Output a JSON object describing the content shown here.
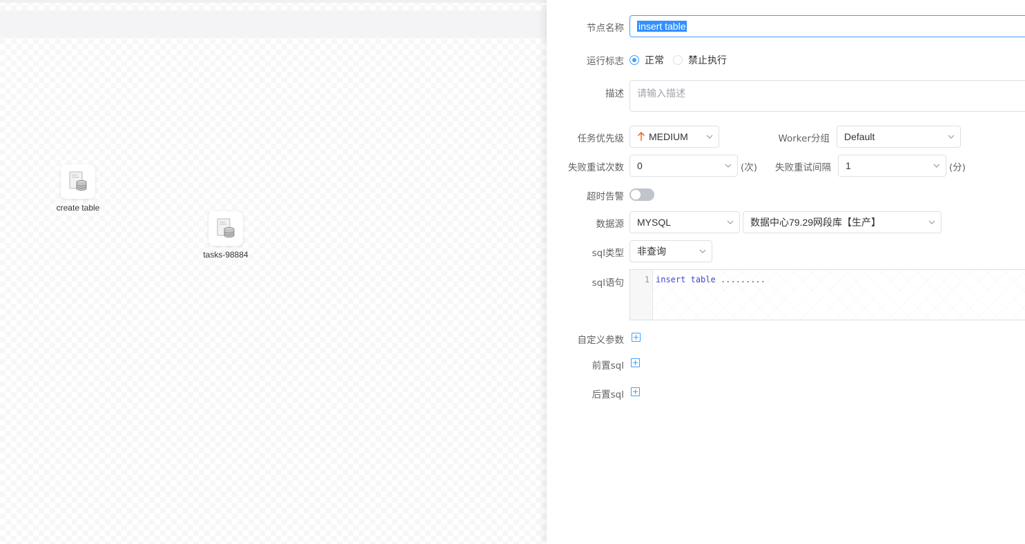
{
  "canvas": {
    "nodes": [
      {
        "label": "create table",
        "icon": "sql-database-icon"
      },
      {
        "label": "tasks-98884",
        "icon": "sql-database-icon"
      }
    ]
  },
  "form": {
    "node_name": {
      "label": "节点名称",
      "value": "insert table"
    },
    "run_flag": {
      "label": "运行标志",
      "options": [
        "正常",
        "禁止执行"
      ],
      "selected": "正常"
    },
    "description": {
      "label": "描述",
      "placeholder": "请输入描述"
    },
    "priority": {
      "label": "任务优先级",
      "value": "MEDIUM",
      "icon": "arrow-up-icon",
      "color": "#f56c2d"
    },
    "worker_group": {
      "label": "Worker分组",
      "value": "Default"
    },
    "retry_times": {
      "label": "失败重试次数",
      "value": "0",
      "suffix": "(次)"
    },
    "retry_interval": {
      "label": "失败重试间隔",
      "value": "1",
      "suffix": "(分)"
    },
    "timeout_alert": {
      "label": "超时告警",
      "enabled": false
    },
    "datasource": {
      "label": "数据源",
      "type": "MYSQL",
      "instance": "数据中心79.29网段库【生产】"
    },
    "sql_type": {
      "label": "sql类型",
      "value": "非查询"
    },
    "sql_statement": {
      "label": "sql语句",
      "line_number": "1",
      "keyword1": "insert",
      "keyword2": "table",
      "rest": "........."
    },
    "custom_params": {
      "label": "自定义参数"
    },
    "pre_sql": {
      "label": "前置sql"
    },
    "post_sql": {
      "label": "后置sql"
    }
  },
  "colors": {
    "accent": "#409eff",
    "priority_arrow": "#f56c2d",
    "selection": "#3390ff"
  }
}
